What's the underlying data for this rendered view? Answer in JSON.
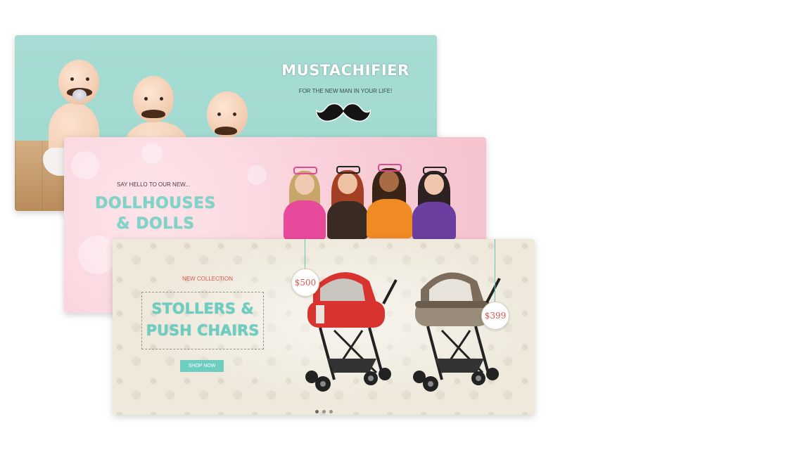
{
  "banners": [
    {
      "title": "MUSTACHIFIER",
      "subtitle": "FOR THE NEW MAN IN YOUR LIFE!",
      "icon": "mustache-icon",
      "background": "#a6dcd3"
    },
    {
      "eyebrow": "SAY HELLO TO OUR NEW...",
      "title_line1": "DOLLHOUSES",
      "title_line2": "& DOLLS",
      "background": "#f9cfd8",
      "title_color": "#7fd3c7"
    },
    {
      "eyebrow": "NEW COLLECTION",
      "title_line1": "STOLLERS &",
      "title_line2": "PUSH CHAIRS",
      "button_label": "SHOP NOW",
      "price_1": "$500",
      "price_2": "$399",
      "background": "#efe9dc",
      "accent": "#6ccdc0",
      "price_color": "#e0524f",
      "stroller_1_color": "#d8332e",
      "stroller_2_color": "#7b6c5c",
      "slide_count": 3,
      "active_slide": 1
    }
  ]
}
